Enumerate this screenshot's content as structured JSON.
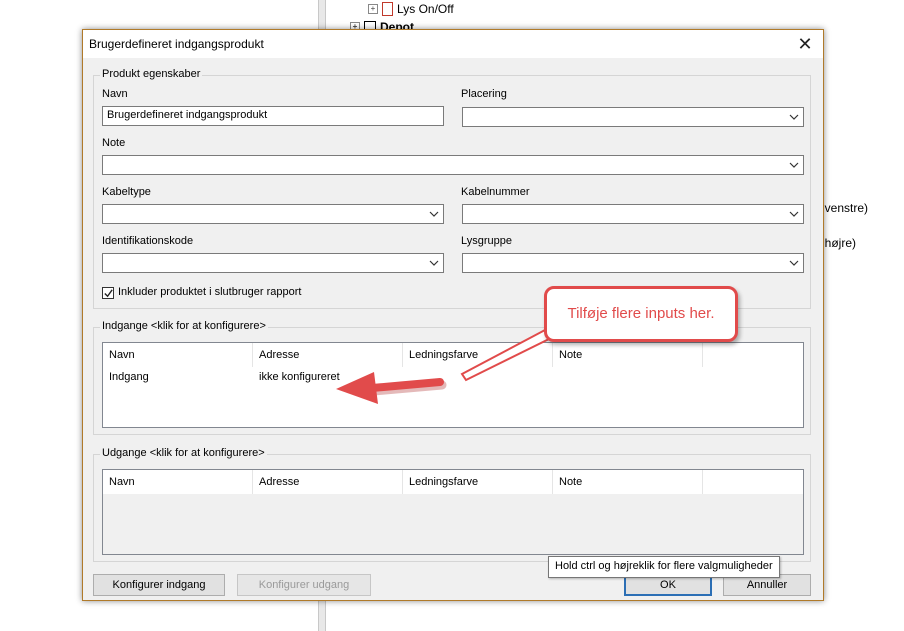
{
  "background": {
    "tree": [
      {
        "label": "Lys On/Off"
      },
      {
        "label": "Depot"
      }
    ],
    "side_texts": [
      "t venstre)",
      "t højre)"
    ]
  },
  "dialog": {
    "title": "Brugerdefineret indgangsprodukt",
    "properties": {
      "legend": "Produkt egenskaber",
      "navn_label": "Navn",
      "navn_value": "Brugerdefineret indgangsprodukt",
      "placering_label": "Placering",
      "note_label": "Note",
      "kabeltype_label": "Kabeltype",
      "kabelnummer_label": "Kabelnummer",
      "identifikationskode_label": "Identifikationskode",
      "lysgruppe_label": "Lysgruppe",
      "include_checkbox_label": "Inkluder produktet i slutbruger rapport",
      "include_checked": true
    },
    "inputs": {
      "legend": "Indgange <klik for at konfigurere>",
      "columns": [
        "Navn",
        "Adresse",
        "Ledningsfarve",
        "Note"
      ],
      "rows": [
        {
          "navn": "Indgang",
          "adresse": "ikke konfigureret",
          "ledningsfarve": "",
          "note": ""
        }
      ]
    },
    "outputs": {
      "legend": "Udgange <klik for at konfigurere>",
      "columns": [
        "Navn",
        "Adresse",
        "Ledningsfarve",
        "Note"
      ]
    },
    "buttons": {
      "configure_input": "Konfigurer indgang",
      "configure_output": "Konfigurer udgang",
      "ok": "OK",
      "cancel": "Annuller"
    },
    "tooltip": "Hold ctrl og højreklik for flere valgmuligheder"
  },
  "annotation": {
    "callout_text": "Tilføje flere inputs her.",
    "color": "#e14b4b"
  }
}
